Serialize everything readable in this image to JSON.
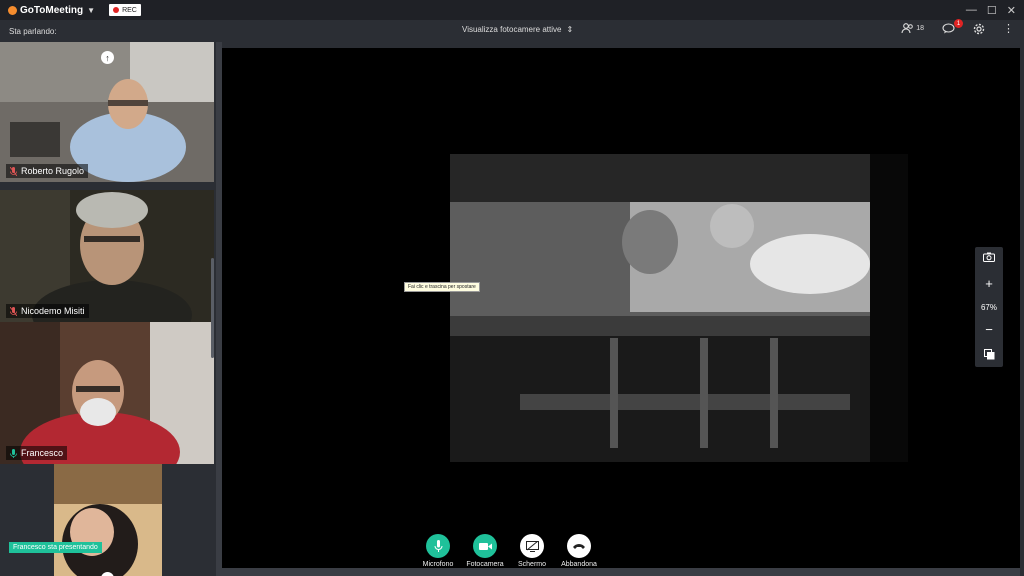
{
  "app": {
    "name": "GoToMeeting",
    "rec_label": "REC"
  },
  "window_controls": {
    "minimize": "—",
    "maximize": "☐",
    "close": "✕"
  },
  "subbar": {
    "speaking_label": "Sta parlando:",
    "camera_selector": "Visualizza fotocamere attive",
    "attendees_count": "18",
    "chat_badge": "1"
  },
  "participants": [
    {
      "name": "Roberto Rugolo",
      "mic": "muted"
    },
    {
      "name": "Nicodemo Misiti",
      "mic": "muted"
    },
    {
      "name": "Francesco",
      "mic": "active"
    }
  ],
  "presenting_label": "Francesco sta presentando",
  "tooltip": "Fai clic e trascina per spostare",
  "zoom": {
    "level": "67%"
  },
  "controls": [
    {
      "label": "Microfono"
    },
    {
      "label": "Fotocamera"
    },
    {
      "label": "Schermo"
    },
    {
      "label": "Abbandona"
    }
  ],
  "colors": {
    "accent": "#1fc19a",
    "muted": "#e05555",
    "badge": "#e02424",
    "logo": "#f68d2e"
  }
}
